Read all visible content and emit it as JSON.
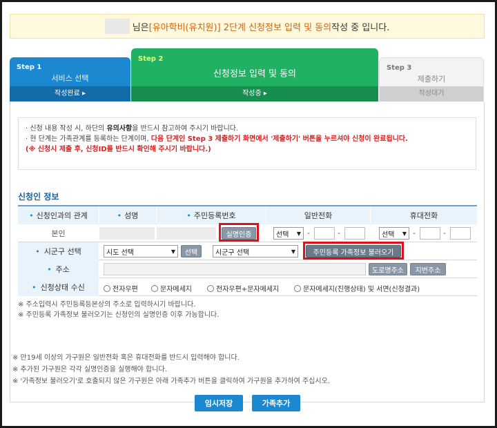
{
  "banner": {
    "suffix_pre": "님은 ",
    "highlight": "[유아학비(유치원)] 2단계 신청정보 입력 및 동의",
    "suffix_post": " 작성 중 입니다."
  },
  "steps": [
    {
      "num": "Step 1",
      "name": "서비스 선택",
      "status": "작성완료 ▸"
    },
    {
      "num": "Step 2",
      "name": "신청정보 입력 및 동의",
      "status": "작성중 ▸"
    },
    {
      "num": "Step 3",
      "name": "제출하기",
      "status": "작성대기"
    }
  ],
  "notice": {
    "line1_pre": "· 신청 내용 작성 시, 하단의 ",
    "line1_bold": "유의사항",
    "line1_post": "을 반드시 참고하여 주시기 바랍니다.",
    "line2_pre": "· 현 단계는 가족관계를 등록하는 단계이며, ",
    "line2_red": "다음 단계인 Step 3 제출하기 화면에서 '제출하기' 버튼을 누르셔야 신청이 완료됩니다.",
    "line3_red": "(※ 신청시 제출 후, 신청ID를 반드시 확인해 주시기 바랍니다.)"
  },
  "section_title": "신청인 정보",
  "table": {
    "headers": {
      "relation": "신청인과의 관계",
      "name": "성명",
      "rrn": "주민등록번호",
      "phone": "일반전화",
      "mobile": "휴대전화"
    },
    "row1": {
      "relation": "본인",
      "verify_button": "실명인증",
      "phone_select": "선택",
      "mobile_select": "선택"
    },
    "district": {
      "label": "시군구 선택",
      "sido_select": "시도 선택",
      "select_button": "선택",
      "sigungu_select": "시군구 선택",
      "load_family_button": "주민등록 가족정보 불러오기"
    },
    "address": {
      "label": "주소",
      "road_button": "도로명주소",
      "lot_button": "지번주소"
    },
    "receive": {
      "label": "신청상태 수신",
      "options": [
        "전자우편",
        "문자메세지",
        "전자우편+문자메세지",
        "문자메세지(진행상태) 및 서면(신청결과)"
      ]
    }
  },
  "notes_table": [
    "※ 주소입력시 주민등록등본상의 주소로 입력하시기 바랍니다.",
    "※ 주민등록 가족정보 불러오기는 신청인의 실명인증 이후 가능합니다."
  ],
  "notes_bottom": [
    "※ 만19세 이상의 가구원은 일반전화 혹은 휴대전화를 반드시 입력해야 합니다.",
    "※ 추가된 가구원은 각각 실명인증을 실행해야 합니다.",
    "※ '가족정보 불러오기'로 호출되지 않은 가구원은 아래 가족추가 버튼을 클릭하여 가구원을 추가하여 주십시오."
  ],
  "footer": {
    "save_label": "임시저장",
    "add_family_label": "가족추가"
  },
  "colors": {
    "step1": "#1c88cf",
    "step2": "#21b164",
    "step3": "#f3f3f3",
    "highlight": "#d4650b",
    "alert_red": "#d52121",
    "button_blue": "#1c88cf"
  }
}
